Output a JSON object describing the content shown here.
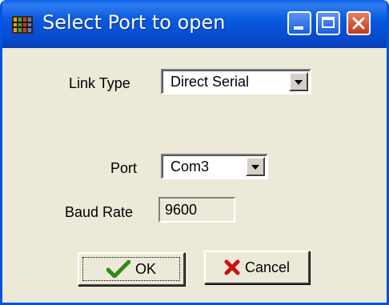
{
  "window": {
    "title": "Select Port to open",
    "icon": "app-grid-icon",
    "controls": {
      "minimize_icon": "minimize-icon",
      "maximize_icon": "maximize-icon",
      "close_icon": "close-icon"
    }
  },
  "form": {
    "link_type_label": "Link Type",
    "link_type_value": "Direct Serial",
    "port_label": "Port",
    "port_value": "Com3",
    "baud_rate_label": "Baud Rate",
    "baud_rate_value": "9600"
  },
  "buttons": {
    "ok_label": "OK",
    "ok_icon": "checkmark-icon",
    "cancel_label": "Cancel",
    "cancel_icon": "red-x-icon"
  },
  "colors": {
    "titlebar": "#0a5ae0",
    "dialog_bg": "#ece9d8",
    "close_button": "#c2391b",
    "ok_check": "#2e8b1a",
    "cancel_x": "#cc1111"
  }
}
